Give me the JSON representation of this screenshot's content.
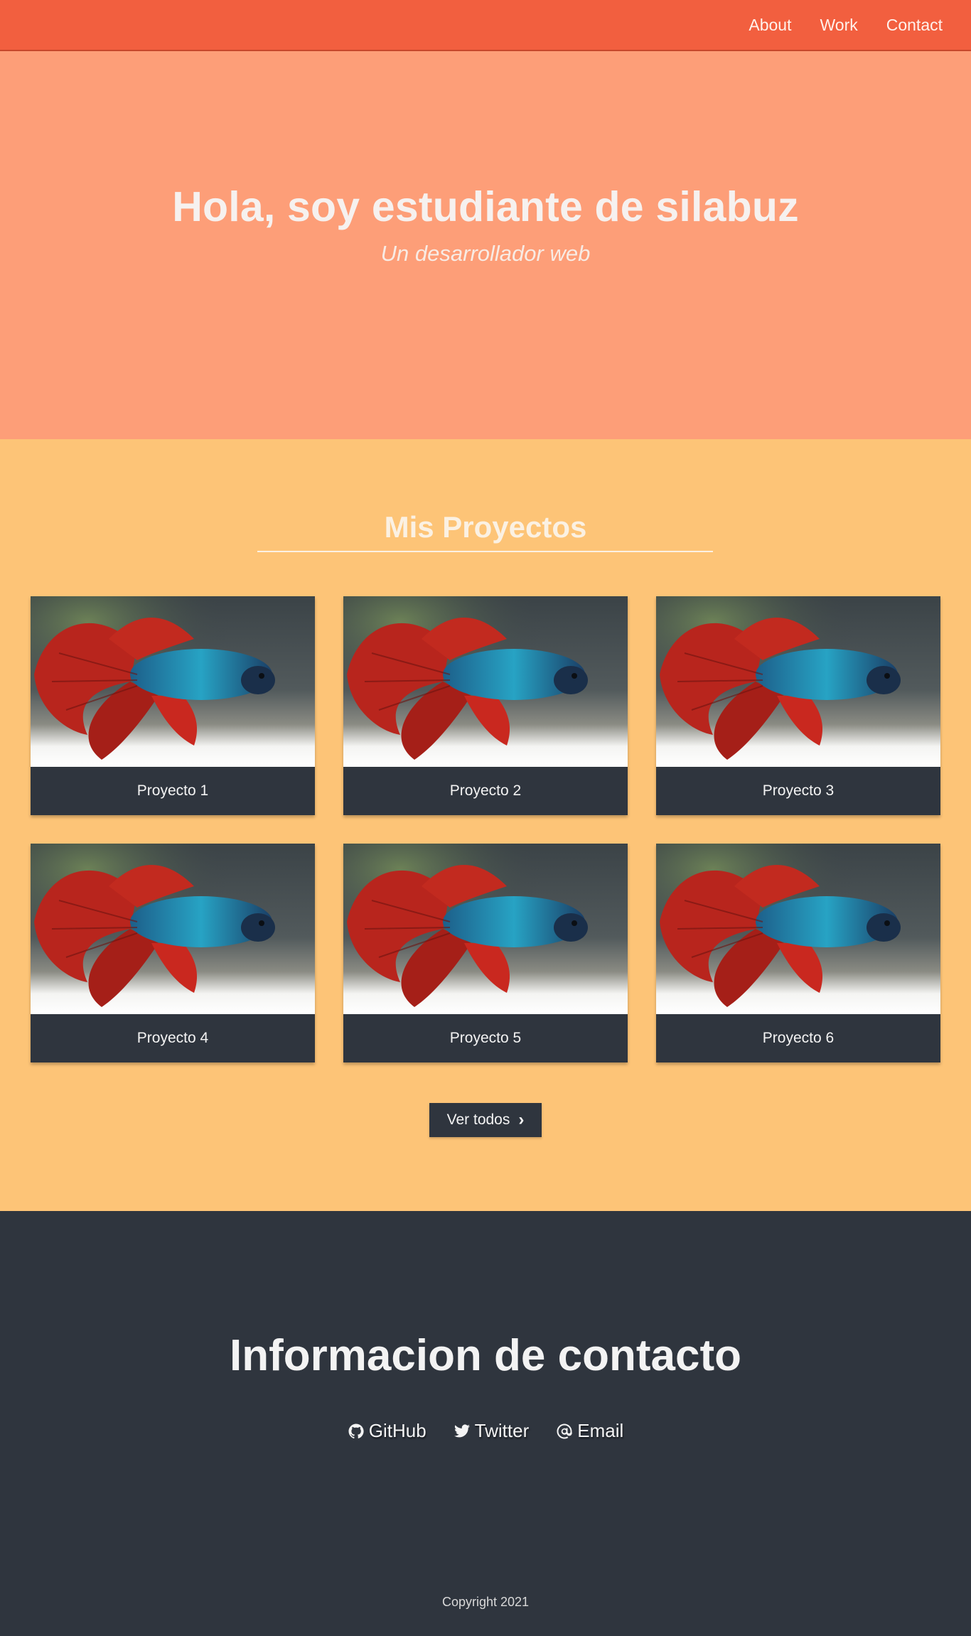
{
  "nav": {
    "about": "About",
    "work": "Work",
    "contact": "Contact"
  },
  "hero": {
    "title": "Hola, soy estudiante de silabuz",
    "subtitle": "Un desarrollador web"
  },
  "projects": {
    "title": "Mis Proyectos",
    "items": [
      {
        "label": "Proyecto 1"
      },
      {
        "label": "Proyecto 2"
      },
      {
        "label": "Proyecto 3"
      },
      {
        "label": "Proyecto 4"
      },
      {
        "label": "Proyecto 5"
      },
      {
        "label": "Proyecto 6"
      }
    ],
    "button_label": "Ver todos"
  },
  "contact": {
    "title": "Informacion de contacto",
    "links": [
      {
        "label": "GitHub",
        "icon": "github-icon"
      },
      {
        "label": "Twitter",
        "icon": "twitter-icon"
      },
      {
        "label": "Email",
        "icon": "at-icon"
      }
    ],
    "copyright": "Copyright 2021"
  },
  "colors": {
    "nav": "#f25f3f",
    "hero": "#fd9e78",
    "projects": "#fdc477",
    "dark": "#2f353e"
  }
}
